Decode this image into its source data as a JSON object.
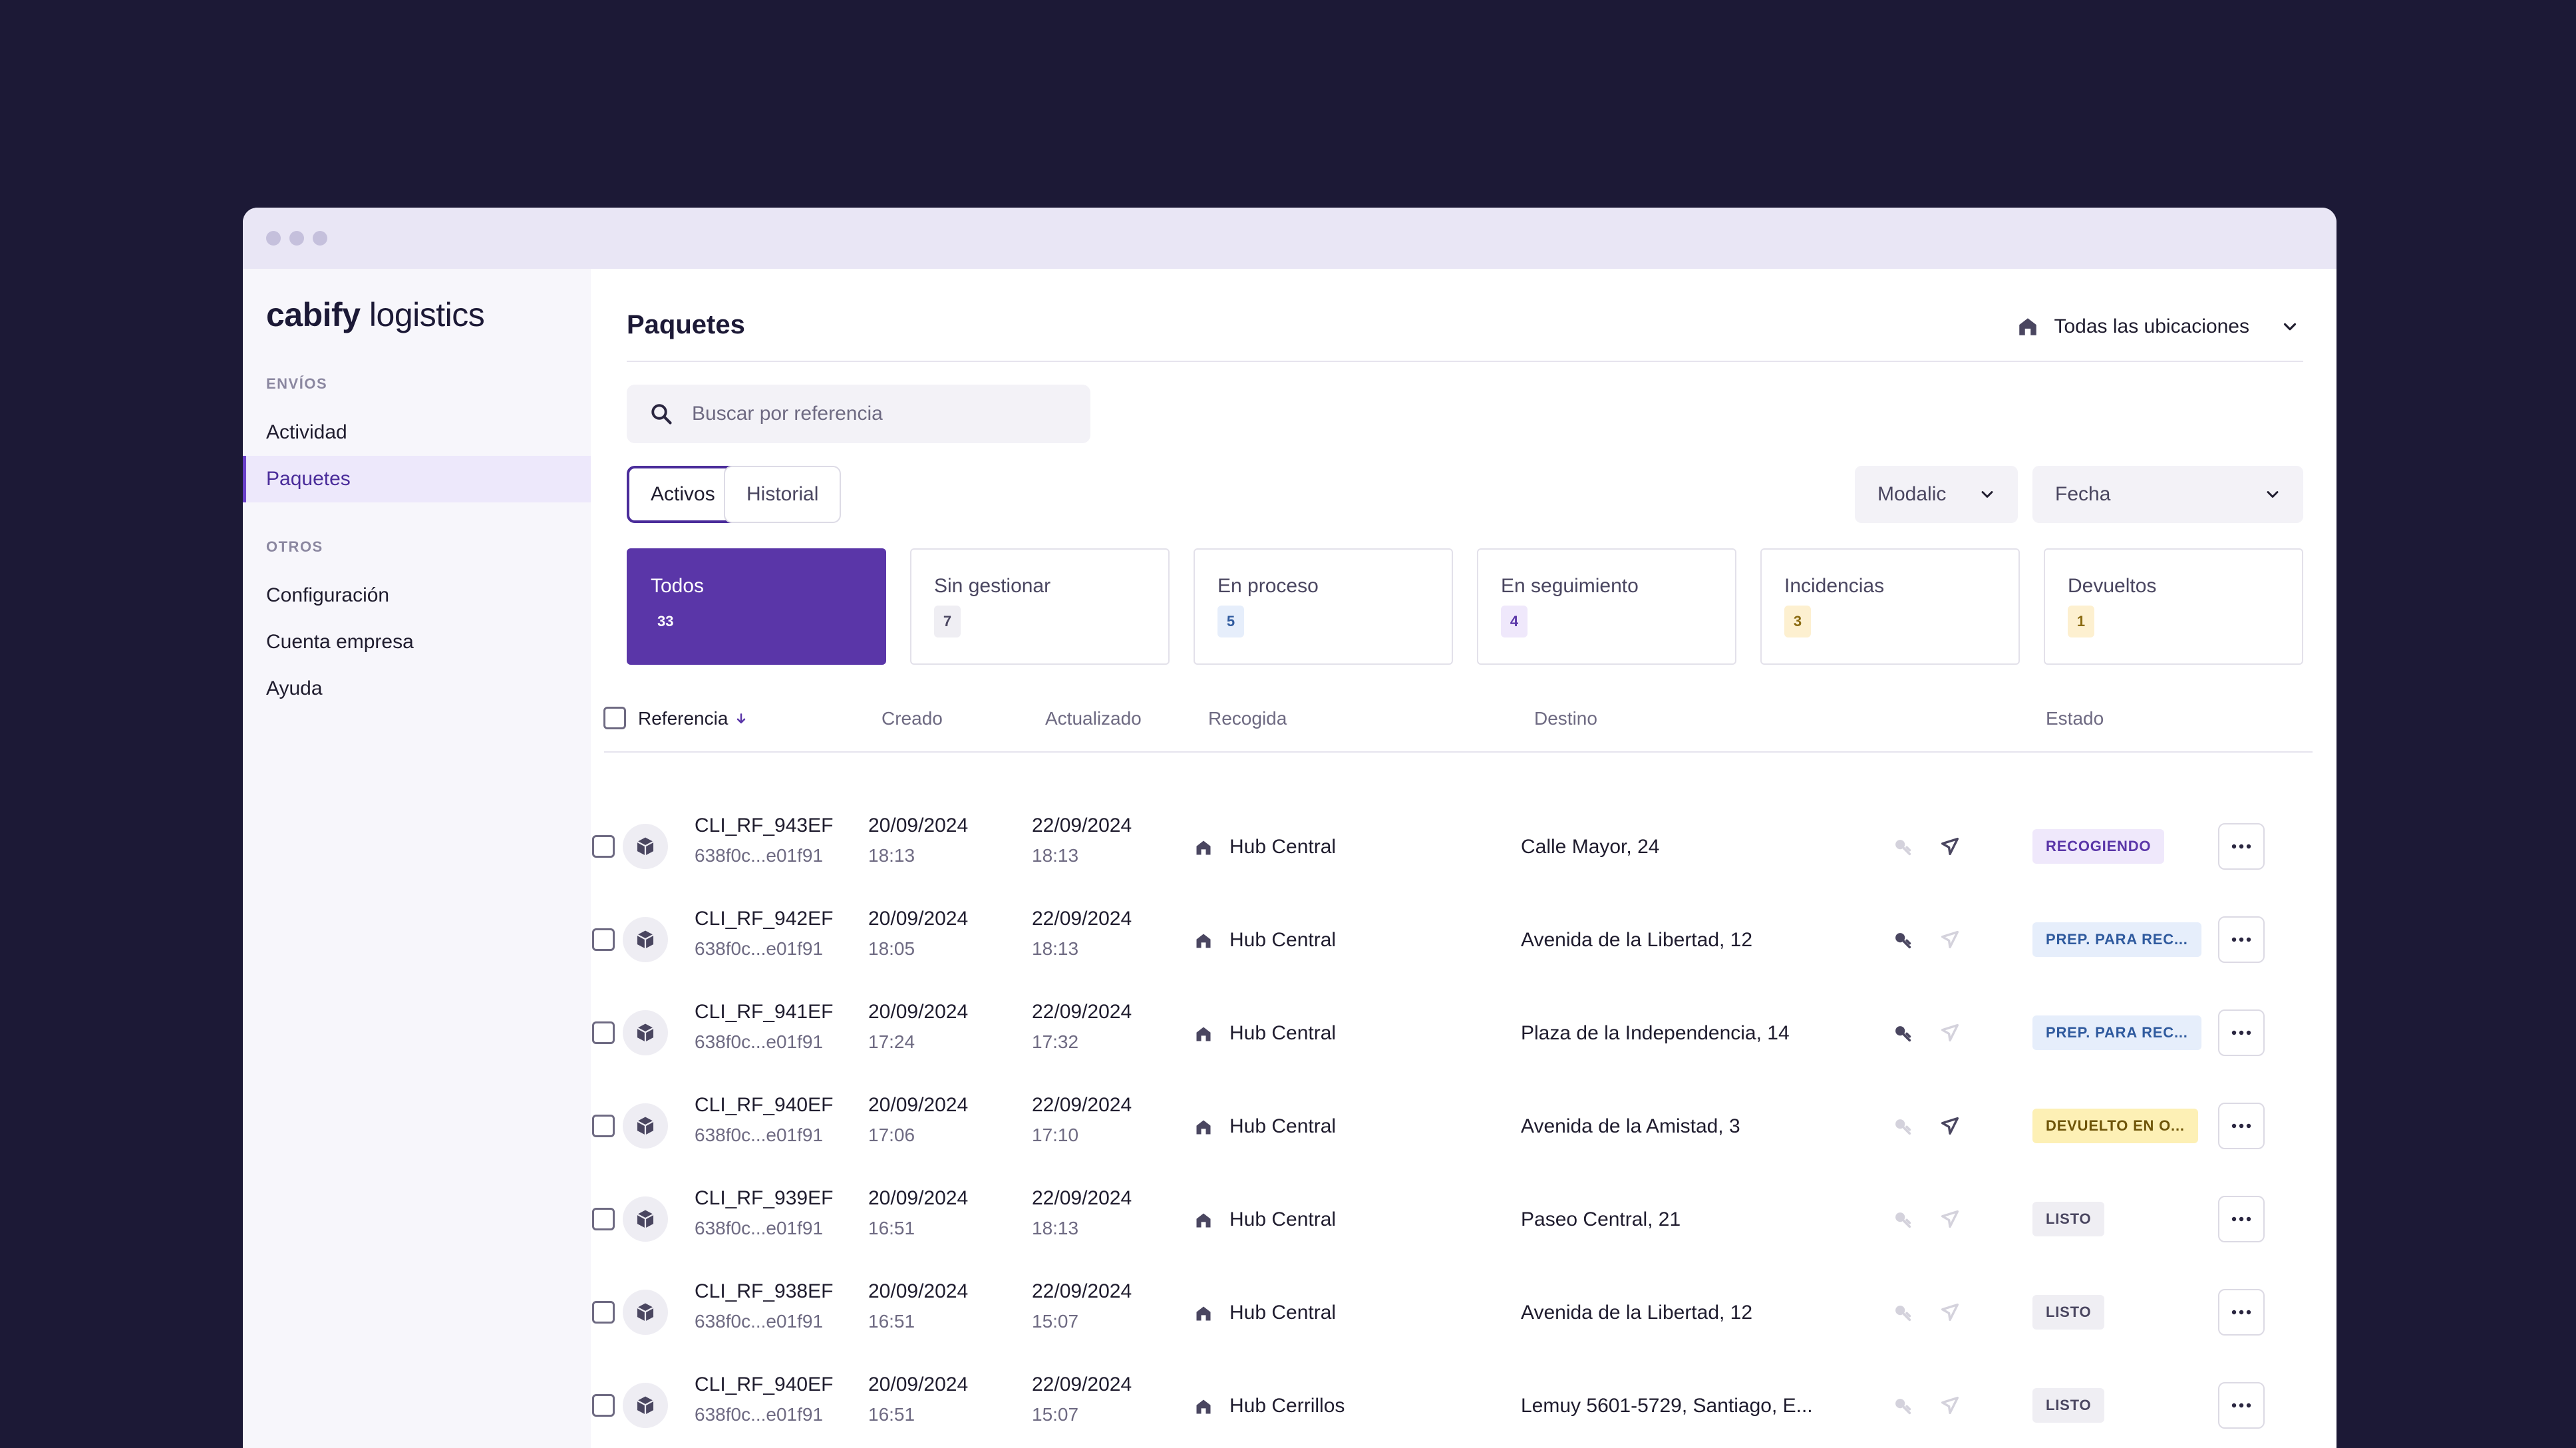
{
  "sidebar": {
    "logo_brand": "cabify",
    "logo_product": " logistics",
    "section_envios": "ENVÍOS",
    "item_actividad": "Actividad",
    "item_paquetes": "Paquetes",
    "section_otros": "OTROS",
    "item_configuracion": "Configuración",
    "item_cuenta": "Cuenta empresa",
    "item_ayuda": "Ayuda"
  },
  "header": {
    "title": "Paquetes",
    "location": "Todas las ubicaciones"
  },
  "search": {
    "placeholder": "Buscar por referencia"
  },
  "tabs": {
    "active": "Activos",
    "history": "Historial"
  },
  "filters": {
    "modalidad": "Modalic",
    "fecha": "Fecha"
  },
  "cards": [
    {
      "label": "Todos",
      "count": "33"
    },
    {
      "label": "Sin gestionar",
      "count": "7"
    },
    {
      "label": "En proceso",
      "count": "5"
    },
    {
      "label": "En seguimiento",
      "count": "4"
    },
    {
      "label": "Incidencias",
      "count": "3"
    },
    {
      "label": "Devueltos",
      "count": "1"
    }
  ],
  "columns": {
    "referencia": "Referencia",
    "creado": "Creado",
    "actualizado": "Actualizado",
    "recogida": "Recogida",
    "destino": "Destino",
    "estado": "Estado"
  },
  "rows": [
    {
      "ref": "CLI_RF_943EF",
      "id": "638f0c...e01f91",
      "c_date": "20/09/2024",
      "c_time": "18:13",
      "u_date": "22/09/2024",
      "u_time": "18:13",
      "pickup": "Hub Central",
      "dest": "Calle Mayor, 24",
      "status": "RECOGIENDO"
    },
    {
      "ref": "CLI_RF_942EF",
      "id": "638f0c...e01f91",
      "c_date": "20/09/2024",
      "c_time": "18:05",
      "u_date": "22/09/2024",
      "u_time": "18:13",
      "pickup": "Hub Central",
      "dest": "Avenida de la Libertad, 12",
      "status": "PREP. PARA REC..."
    },
    {
      "ref": "CLI_RF_941EF",
      "id": "638f0c...e01f91",
      "c_date": "20/09/2024",
      "c_time": "17:24",
      "u_date": "22/09/2024",
      "u_time": "17:32",
      "pickup": "Hub Central",
      "dest": "Plaza de la Independencia, 14",
      "status": "PREP. PARA REC..."
    },
    {
      "ref": "CLI_RF_940EF",
      "id": "638f0c...e01f91",
      "c_date": "20/09/2024",
      "c_time": "17:06",
      "u_date": "22/09/2024",
      "u_time": "17:10",
      "pickup": "Hub Central",
      "dest": "Avenida de la Amistad, 3",
      "status": "DEVUELTO EN O..."
    },
    {
      "ref": "CLI_RF_939EF",
      "id": "638f0c...e01f91",
      "c_date": "20/09/2024",
      "c_time": "16:51",
      "u_date": "22/09/2024",
      "u_time": "18:13",
      "pickup": "Hub Central",
      "dest": "Paseo Central, 21",
      "status": "LISTO"
    },
    {
      "ref": "CLI_RF_938EF",
      "id": "638f0c...e01f91",
      "c_date": "20/09/2024",
      "c_time": "16:51",
      "u_date": "22/09/2024",
      "u_time": "15:07",
      "pickup": "Hub Central",
      "dest": "Avenida de la Libertad, 12",
      "status": "LISTO"
    },
    {
      "ref": "CLI_RF_940EF",
      "id": "638f0c...e01f91",
      "c_date": "20/09/2024",
      "c_time": "16:51",
      "u_date": "22/09/2024",
      "u_time": "15:07",
      "pickup": "Hub Cerrillos",
      "dest": "Lemuy 5601-5729, Santiago, E...",
      "status": "LISTO"
    }
  ],
  "colors": {
    "background": "#1c1936",
    "accent": "#5a36a8",
    "status_recogiendo": "#efe8fb",
    "status_prep": "#e6eefb",
    "status_devuelto": "#fdf0b5",
    "status_listo": "#efeef3"
  }
}
